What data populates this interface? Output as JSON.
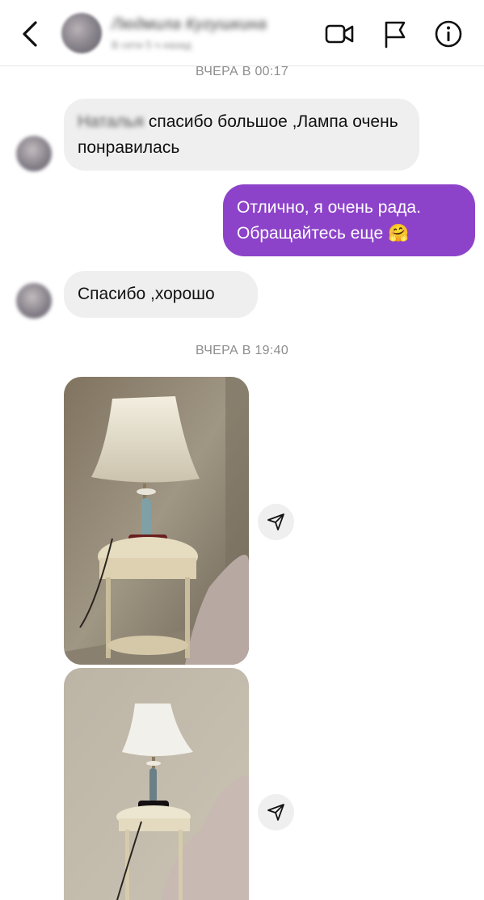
{
  "header": {
    "contact_name": "Людмила Кугушкина",
    "contact_subtitle": "В сети 5 ч назад",
    "icons": [
      "back-arrow-icon",
      "video-camera-icon",
      "flag-icon",
      "info-icon"
    ]
  },
  "thread": {
    "timestamp_1": "ВЧЕРА В 00:17",
    "msg1_name": "Наталья",
    "msg1_text": " спасибо большое ,Лампа очень понравилась",
    "msg2_text": "Отлично, я очень рада. Обращайтесь еще 🤗",
    "msg3_text": "Спасибо ,хорошо",
    "timestamp_2": "ВЧЕРА В 19:40"
  },
  "colors": {
    "outgoing_bubble": "#8d43c9",
    "incoming_bubble": "#efefef",
    "timestamp": "#8e8e8e"
  }
}
